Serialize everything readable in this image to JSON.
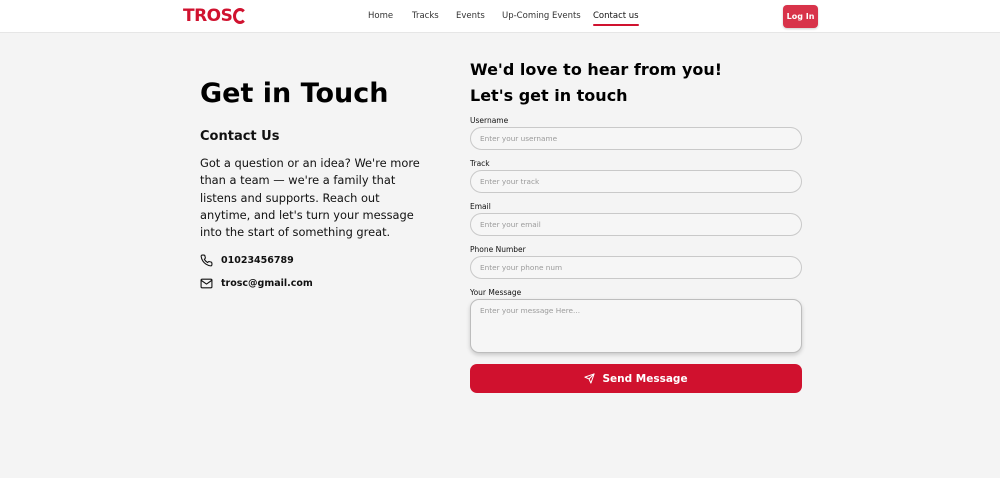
{
  "header": {
    "logo_text": "TROS",
    "nav": [
      {
        "label": "Home"
      },
      {
        "label": "Tracks"
      },
      {
        "label": "Events"
      },
      {
        "label": "Up-Coming Events"
      },
      {
        "label": "Contact us",
        "active": true
      }
    ],
    "login_label": "Log In"
  },
  "left": {
    "title": "Get in Touch",
    "subtitle": "Contact Us",
    "intro": "Got a question or an idea? We're more than a team — we're a family that listens and supports. Reach out anytime, and let's turn your message into the start of something great.",
    "phone": "01023456789",
    "email": "trosc@gmail.com",
    "icons": {
      "phone": "phone-icon",
      "email": "mail-icon"
    }
  },
  "form": {
    "heading1": "We'd love to hear from you!",
    "heading2": "Let's get in touch",
    "fields": {
      "username": {
        "label": "Username",
        "placeholder": "Enter your username",
        "value": ""
      },
      "track": {
        "label": "Track",
        "placeholder": "Enter your track",
        "value": ""
      },
      "email": {
        "label": "Email",
        "placeholder": "Enter your email",
        "value": ""
      },
      "phone": {
        "label": "Phone Number",
        "placeholder": "Enter your phone num",
        "value": ""
      },
      "message": {
        "label": "Your Message",
        "placeholder": "Enter your message Here...",
        "value": ""
      }
    },
    "submit_label": "Send Message",
    "submit_icon": "send-icon"
  },
  "colors": {
    "brand": "#d0122f",
    "login_button": "#d8334a",
    "background": "#f4f4f4"
  }
}
